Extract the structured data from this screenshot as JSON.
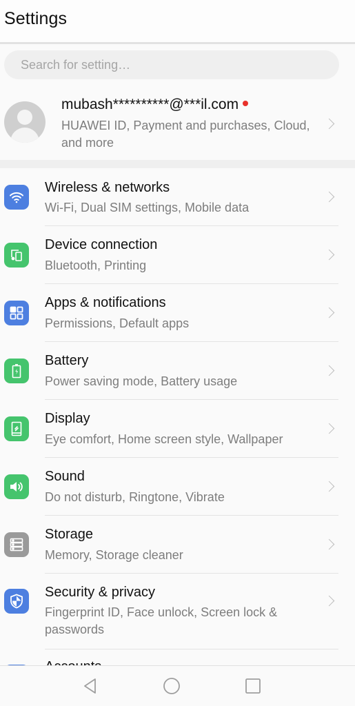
{
  "header": {
    "title": "Settings"
  },
  "search": {
    "placeholder": "Search for setting…"
  },
  "account": {
    "email": "mubash**********@***il.com",
    "subtitle": "HUAWEI ID, Payment and purchases, Cloud, and more",
    "has_notification": true,
    "notification_color": "#e8312b"
  },
  "settings": [
    {
      "title": "Wireless & networks",
      "subtitle": "Wi-Fi, Dual SIM settings, Mobile data",
      "icon": "wifi-icon",
      "color": "#4d7fe0"
    },
    {
      "title": "Device connection",
      "subtitle": "Bluetooth, Printing",
      "icon": "device-connection-icon",
      "color": "#45c46d"
    },
    {
      "title": "Apps & notifications",
      "subtitle": "Permissions, Default apps",
      "icon": "apps-grid-icon",
      "color": "#4d7fe0"
    },
    {
      "title": "Battery",
      "subtitle": "Power saving mode, Battery usage",
      "icon": "battery-icon",
      "color": "#45c46d"
    },
    {
      "title": "Display",
      "subtitle": "Eye comfort, Home screen style, Wallpaper",
      "icon": "display-icon",
      "color": "#45c46d"
    },
    {
      "title": "Sound",
      "subtitle": "Do not disturb, Ringtone, Vibrate",
      "icon": "speaker-icon",
      "color": "#45c46d"
    },
    {
      "title": "Storage",
      "subtitle": "Memory, Storage cleaner",
      "icon": "storage-icon",
      "color": "#9a9a9a"
    },
    {
      "title": "Security & privacy",
      "subtitle": "Fingerprint ID, Face unlock, Screen lock & passwords",
      "icon": "shield-icon",
      "color": "#4d7fe0"
    },
    {
      "title": "Accounts",
      "subtitle": "",
      "icon": "accounts-icon",
      "color": "#4d7fe0"
    }
  ],
  "navbar": {
    "back": "back-icon",
    "home": "home-icon",
    "recents": "recents-icon"
  }
}
